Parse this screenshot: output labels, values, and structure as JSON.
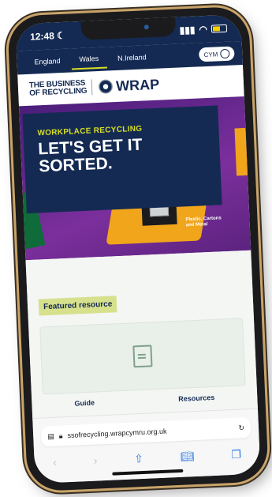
{
  "status": {
    "time": "12:48",
    "moon_icon": "moon-icon",
    "signal_icon": "signal-icon",
    "wifi_icon": "wifi-icon",
    "battery_icon": "battery-icon"
  },
  "nav": {
    "tabs": [
      {
        "label": "England",
        "active": false
      },
      {
        "label": "Wales",
        "active": true
      },
      {
        "label": "N.Ireland",
        "active": false
      }
    ],
    "language_button": "CYM"
  },
  "brand": {
    "business_line1": "THE BUSINESS",
    "business_line2": "OF RECYCLING",
    "wrap": "WRAP"
  },
  "hero": {
    "kicker": "WORKPLACE RECYCLING",
    "headline_line1": "LET'S GET IT",
    "headline_line2": "SORTED.",
    "bin_label_line1": "Plastic, Cartons",
    "bin_label_line2": "and Metal"
  },
  "main": {
    "featured_label": "Featured resource",
    "card_icon": "document-icon",
    "left_label": "Guide",
    "right_label": "Resources"
  },
  "browser": {
    "url": "ssofrecycling.wrapcymru.org.uk",
    "lock_icon": "lock-icon",
    "reload_icon": "reload-icon",
    "toolbar": [
      "back-icon",
      "forward-icon",
      "share-icon",
      "bookmarks-icon",
      "tabs-icon"
    ]
  },
  "colors": {
    "navy": "#142a53",
    "lime": "#d7df23",
    "purple": "#7b2f9c",
    "orange": "#f1a51b"
  }
}
